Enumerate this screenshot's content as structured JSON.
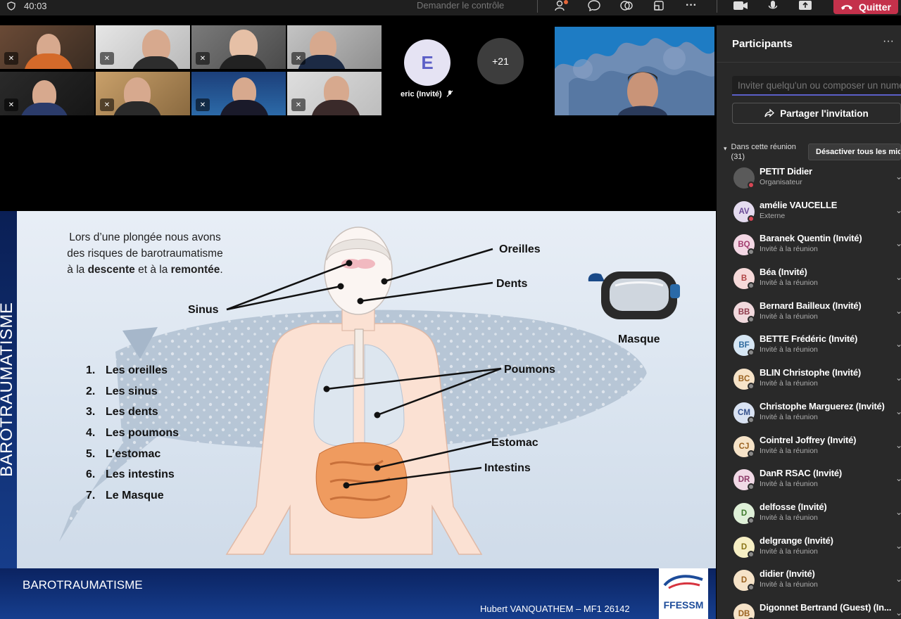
{
  "topbar": {
    "timer": "40:03",
    "take_control": "Demander le contrôle",
    "quit_label": "Quitter"
  },
  "videos": {
    "eric_initial": "E",
    "eric_name": "eric (Invité)",
    "more_count": "+21"
  },
  "slide": {
    "side_title": "BAROTRAUMATISME",
    "intro_line1": "Lors d’une plongée nous avons",
    "intro_line2": "des risques de barotraumatisme",
    "intro_pre": "à la ",
    "intro_descent": "descente",
    "intro_mid": " et à la ",
    "intro_ascent": "remontée",
    "intro_end": ".",
    "list": [
      {
        "n": "1.",
        "text": "Les oreilles"
      },
      {
        "n": "2.",
        "text": "Les sinus"
      },
      {
        "n": "3.",
        "text": "Les dents"
      },
      {
        "n": "4.",
        "text": "Les poumons"
      },
      {
        "n": "5.",
        "text": "L’estomac"
      },
      {
        "n": "6.",
        "text": "Les intestins"
      },
      {
        "n": "7.",
        "text": "Le Masque"
      }
    ],
    "labels": {
      "sinus": "Sinus",
      "oreilles": "Oreilles",
      "dents": "Dents",
      "poumons": "Poumons",
      "estomac": "Estomac",
      "intestins": "Intestins",
      "masque": "Masque"
    },
    "footer_title": "BAROTRAUMATISME",
    "footer_author": "Hubert VANQUATHEM – MF1 26142",
    "logo_text": "FFESSM"
  },
  "sidebar": {
    "title": "Participants",
    "more": "···",
    "invite_placeholder": "Inviter quelqu'un ou composer un numéro",
    "share_label": "Partager l'invitation",
    "in_meeting": "Dans cette réunion",
    "count": "(31)",
    "mute_all": "Désactiver tous les micros",
    "participants": [
      {
        "initials": "",
        "name": "PETIT Didier",
        "role": "Organisateur",
        "bg": "#5a5a5a",
        "fg": "#fff",
        "dot": "red"
      },
      {
        "initials": "AV",
        "name": "amélie VAUCELLE",
        "role": "Externe",
        "bg": "#e4dbef",
        "fg": "#6a4a96",
        "dot": "red"
      },
      {
        "initials": "BQ",
        "name": "Baranek Quentin (Invité)",
        "role": "Invité à la réunion",
        "bg": "#f3d7e4",
        "fg": "#a23c6f",
        "dot": "grey"
      },
      {
        "initials": "B",
        "name": "Béa (Invité)",
        "role": "Invité à la réunion",
        "bg": "#f6d9d9",
        "fg": "#b04545",
        "dot": "grey"
      },
      {
        "initials": "BB",
        "name": "Bernard Bailleux (Invité)",
        "role": "Invité à la réunion",
        "bg": "#f1d9dd",
        "fg": "#8e3b4b",
        "dot": "grey"
      },
      {
        "initials": "BF",
        "name": "BETTE Frédéric (Invité)",
        "role": "Invité à la réunion",
        "bg": "#d6e6f4",
        "fg": "#2f6a9e",
        "dot": "grey"
      },
      {
        "initials": "BC",
        "name": "BLIN Christophe (Invité)",
        "role": "Invité à la réunion",
        "bg": "#f6e3c8",
        "fg": "#9a6220",
        "dot": "grey"
      },
      {
        "initials": "CM",
        "name": "Christophe Marguerez (Invité)",
        "role": "Invité à la réunion",
        "bg": "#d9e2f2",
        "fg": "#35508c",
        "dot": "grey"
      },
      {
        "initials": "CJ",
        "name": "Cointrel Joffrey (Invité)",
        "role": "Invité à la réunion",
        "bg": "#f6e3c8",
        "fg": "#9a6220",
        "dot": "grey"
      },
      {
        "initials": "DR",
        "name": "DanR RSAC (Invité)",
        "role": "Invité à la réunion",
        "bg": "#f1d9e6",
        "fg": "#8e3b6a",
        "dot": "grey"
      },
      {
        "initials": "D",
        "name": "delfosse (Invité)",
        "role": "Invité à la réunion",
        "bg": "#dff0d8",
        "fg": "#3e7a2c",
        "dot": "grey"
      },
      {
        "initials": "D",
        "name": "delgrange (Invité)",
        "role": "Invité à la réunion",
        "bg": "#f7efc4",
        "fg": "#8a7416",
        "dot": "grey"
      },
      {
        "initials": "D",
        "name": "didier (Invité)",
        "role": "Invité à la réunion",
        "bg": "#f6e3c8",
        "fg": "#9a6220",
        "dot": "grey"
      },
      {
        "initials": "DB",
        "name": "Digonnet Bertrand (Guest) (In...",
        "role": "",
        "bg": "#f6e3c8",
        "fg": "#9a6220",
        "dot": "grey"
      }
    ]
  }
}
